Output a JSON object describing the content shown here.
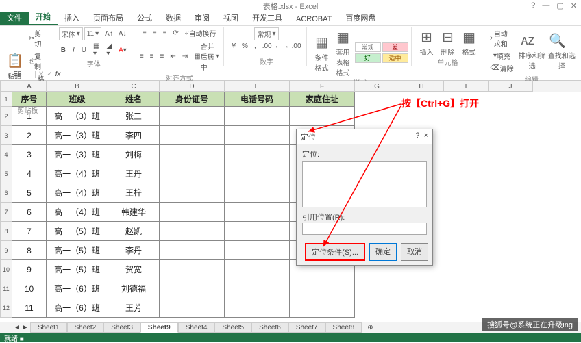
{
  "title": "表格.xlsx - Excel",
  "tabs": {
    "file": "文件",
    "items": [
      "开始",
      "插入",
      "页面布局",
      "公式",
      "数据",
      "审阅",
      "视图",
      "开发工具",
      "ACROBAT",
      "百度网盘"
    ],
    "current": 0
  },
  "ribbon": {
    "clipboard": {
      "paste": "粘贴",
      "cut": "剪切",
      "copy": "复制",
      "painter": "格式刷",
      "label": "剪贴板"
    },
    "font": {
      "name": "宋体",
      "size": "11",
      "label": "字体"
    },
    "align": {
      "wrap": "自动换行",
      "merge": "合并后居中",
      "label": "对齐方式"
    },
    "number": {
      "format": "常规",
      "label": "数字"
    },
    "styles": {
      "cond": "条件格式",
      "tbl": "套用\n表格格式",
      "normal": "常规",
      "bad": "差",
      "good": "好",
      "mid": "适中",
      "label": "样式"
    },
    "cells": {
      "ins": "插入",
      "del": "删除",
      "fmt": "格式",
      "label": "单元格"
    },
    "editing": {
      "sum": "自动求和",
      "fill": "填充",
      "clear": "清除",
      "sort": "排序和筛选",
      "find": "查找和选择",
      "label": "编辑"
    }
  },
  "namebox": "E8",
  "fx": "fx",
  "columns": [
    "A",
    "B",
    "C",
    "D",
    "E",
    "F",
    "G",
    "H",
    "I",
    "J"
  ],
  "headers": [
    "序号",
    "班级",
    "姓名",
    "身份证号",
    "电话号码",
    "家庭住址"
  ],
  "rows": [
    {
      "n": "1",
      "c": "高一（3）班",
      "m": "张三"
    },
    {
      "n": "2",
      "c": "高一（3）班",
      "m": "李四"
    },
    {
      "n": "3",
      "c": "高一（3）班",
      "m": "刘梅"
    },
    {
      "n": "4",
      "c": "高一（4）班",
      "m": "王丹"
    },
    {
      "n": "5",
      "c": "高一（4）班",
      "m": "王梓"
    },
    {
      "n": "6",
      "c": "高一（4）班",
      "m": "韩建华"
    },
    {
      "n": "7",
      "c": "高一（5）班",
      "m": "赵凯"
    },
    {
      "n": "8",
      "c": "高一（5）班",
      "m": "李丹"
    },
    {
      "n": "9",
      "c": "高一（5）班",
      "m": "贺宽"
    },
    {
      "n": "10",
      "c": "高一（6）班",
      "m": "刘德福"
    },
    {
      "n": "11",
      "c": "高一（6）班",
      "m": "王芳"
    }
  ],
  "dialog": {
    "title": "定位",
    "listlabel": "定位:",
    "reflabel": "引用位置(R):",
    "cond": "定位条件(S)...",
    "ok": "确定",
    "cancel": "取消",
    "help": "?",
    "close": "×"
  },
  "annotation": "按【Ctrl+G】打开",
  "sheets": [
    "Sheet1",
    "Sheet2",
    "Sheet3",
    "Sheet9",
    "Sheet4",
    "Sheet5",
    "Sheet6",
    "Sheet7",
    "Sheet8"
  ],
  "currentSheet": 3,
  "status": "就绪  ■",
  "credit": "搜狐号@系统正在升级ing"
}
